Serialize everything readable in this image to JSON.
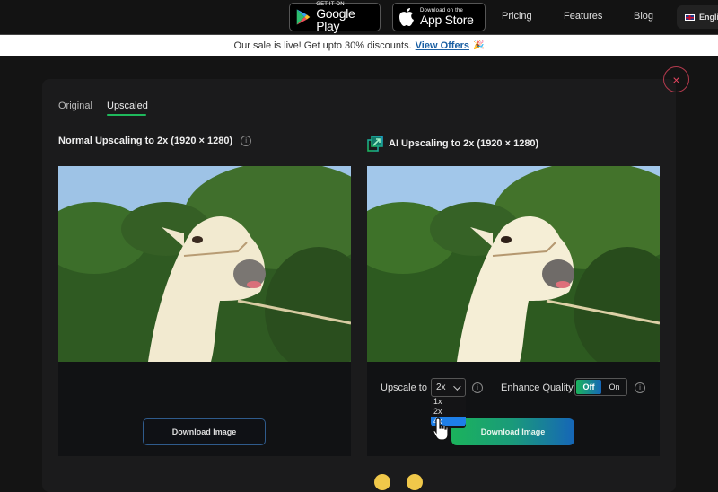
{
  "topnav": {
    "google_play": {
      "small": "GET IT ON",
      "big": "Google Play"
    },
    "app_store": {
      "small": "Download on the",
      "big": "App Store"
    },
    "links": [
      "Pricing",
      "Features",
      "Blog"
    ],
    "language": "English"
  },
  "banner": {
    "text": "Our sale is live! Get upto 30% discounts.",
    "link": "View Offers",
    "emoji": "🎉"
  },
  "modal": {
    "close_icon": "×",
    "tabs": [
      {
        "label": "Original",
        "active": false
      },
      {
        "label": "Upscaled",
        "active": true
      }
    ],
    "left_panel": {
      "title": "Normal Upscaling to 2x (1920 × 1280)",
      "info_icon": "i",
      "download_label": "Download Image"
    },
    "right_panel": {
      "title": "AI Upscaling to 2x (1920 × 1280)",
      "upscale_label": "Upscale to",
      "upscale_value": "2x",
      "upscale_options": [
        "1x",
        "2x",
        "4x"
      ],
      "enhance_label": "Enhance Quality",
      "toggle_off": "Off",
      "toggle_on": "On",
      "toggle_selected": "Off",
      "download_label": "Download Image",
      "info_icon": "i"
    }
  },
  "colors": {
    "accent_green": "#1fb95c",
    "accent_blue": "#1666b8",
    "close_red": "#e0455f",
    "link_blue": "#1a5fa3"
  }
}
